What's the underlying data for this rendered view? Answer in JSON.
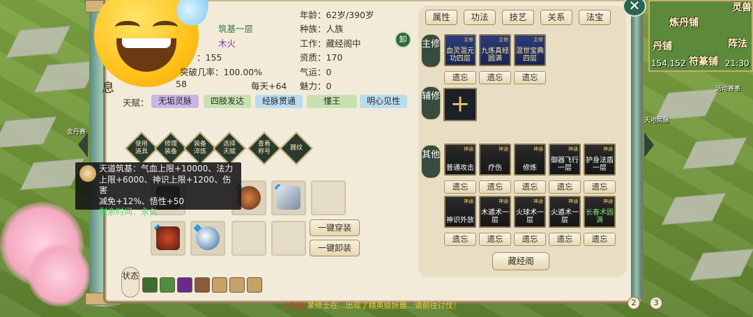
{
  "character": {
    "age_label": "年龄：",
    "age_value": "62岁/390岁",
    "realm_value": "筑基一层",
    "race_label": "种族：",
    "race_value": "人族",
    "element_value": "木火",
    "job_label": "工作：",
    "job_value": "藏经阁中",
    "stat_partial": "：155",
    "aptitude_label": "资质：",
    "aptitude_value": "170",
    "breakthrough_text": "突破几率：100.00%",
    "luck_label": "气运：",
    "luck_value": "0",
    "partial_number": "58",
    "daily_text": "每天+64",
    "charm_label": "魅力：",
    "charm_value": "0",
    "xi_char": "息"
  },
  "talents": {
    "label": "天赋：",
    "items": [
      {
        "text": "无垢灵脉",
        "color": "#c9b6e4"
      },
      {
        "text": "四肢发达",
        "color": "#c7e2b0"
      },
      {
        "text": "经脉贯通",
        "color": "#b9dcef"
      },
      {
        "text": "懂王",
        "color": "#c7e2b0"
      },
      {
        "text": "明心见性",
        "color": "#b9dcef"
      }
    ]
  },
  "actions": [
    "使用道具",
    "修理装备",
    "装备淬炼",
    "选择天赋",
    "查看称号",
    "器纹"
  ],
  "tooltip": {
    "line1": "天道筑基：气血上限+10000、法力",
    "line2": "上限+6000、神识上限+1200、伤害",
    "line3": "减免+12%、悟性+50",
    "time_text": "剩余时间：永久"
  },
  "buttons": {
    "equip_all": "一键穿装",
    "unequip_all": "一键卸装",
    "unload": "卸",
    "close": "✕",
    "library": "藏经阁"
  },
  "status_label": "状态",
  "tabs": [
    "属性",
    "功法",
    "技艺",
    "关系",
    "法宝"
  ],
  "sections": {
    "main": "主修",
    "aux": "辅修",
    "other": "其他"
  },
  "main_skills": [
    {
      "tag": "主修",
      "name": "血灵混元功四层"
    },
    {
      "tag": "主修",
      "name": "九炼真经圆满"
    },
    {
      "tag": "主修",
      "name": "混世宝典四层"
    }
  ],
  "other_skills": [
    {
      "tag": "神通",
      "name": "普通攻击"
    },
    {
      "tag": "神通",
      "name": "疗伤"
    },
    {
      "tag": "神通",
      "name": "修炼"
    },
    {
      "tag": "神通",
      "name": "御器飞行一层"
    },
    {
      "tag": "神通",
      "name": "护身法盾一层"
    },
    {
      "tag": "神通",
      "name": "神识外放"
    },
    {
      "tag": "神通",
      "name": "木遁术一层"
    },
    {
      "tag": "神通",
      "name": "火球术一层"
    },
    {
      "tag": "神通",
      "name": "火遁术一层"
    },
    {
      "tag": "神通",
      "name": "长春术圆满"
    }
  ],
  "forget_label": "遗忘",
  "minimap": {
    "labels": [
      "灵兽",
      "炼丹铺",
      "阵法",
      "丹铺",
      "符篆铺"
    ],
    "coords": "154,152",
    "time": "21:30"
  },
  "side_labels": {
    "left_top": "金丹赛",
    "activity": "活动赛事",
    "right_mid": "天地灵脉"
  },
  "banner": {
    "prefix": "[系统]",
    "text": "某修士在…出现了精英级妖兽…请前往讨伐！"
  },
  "pages": [
    "2",
    "3"
  ]
}
